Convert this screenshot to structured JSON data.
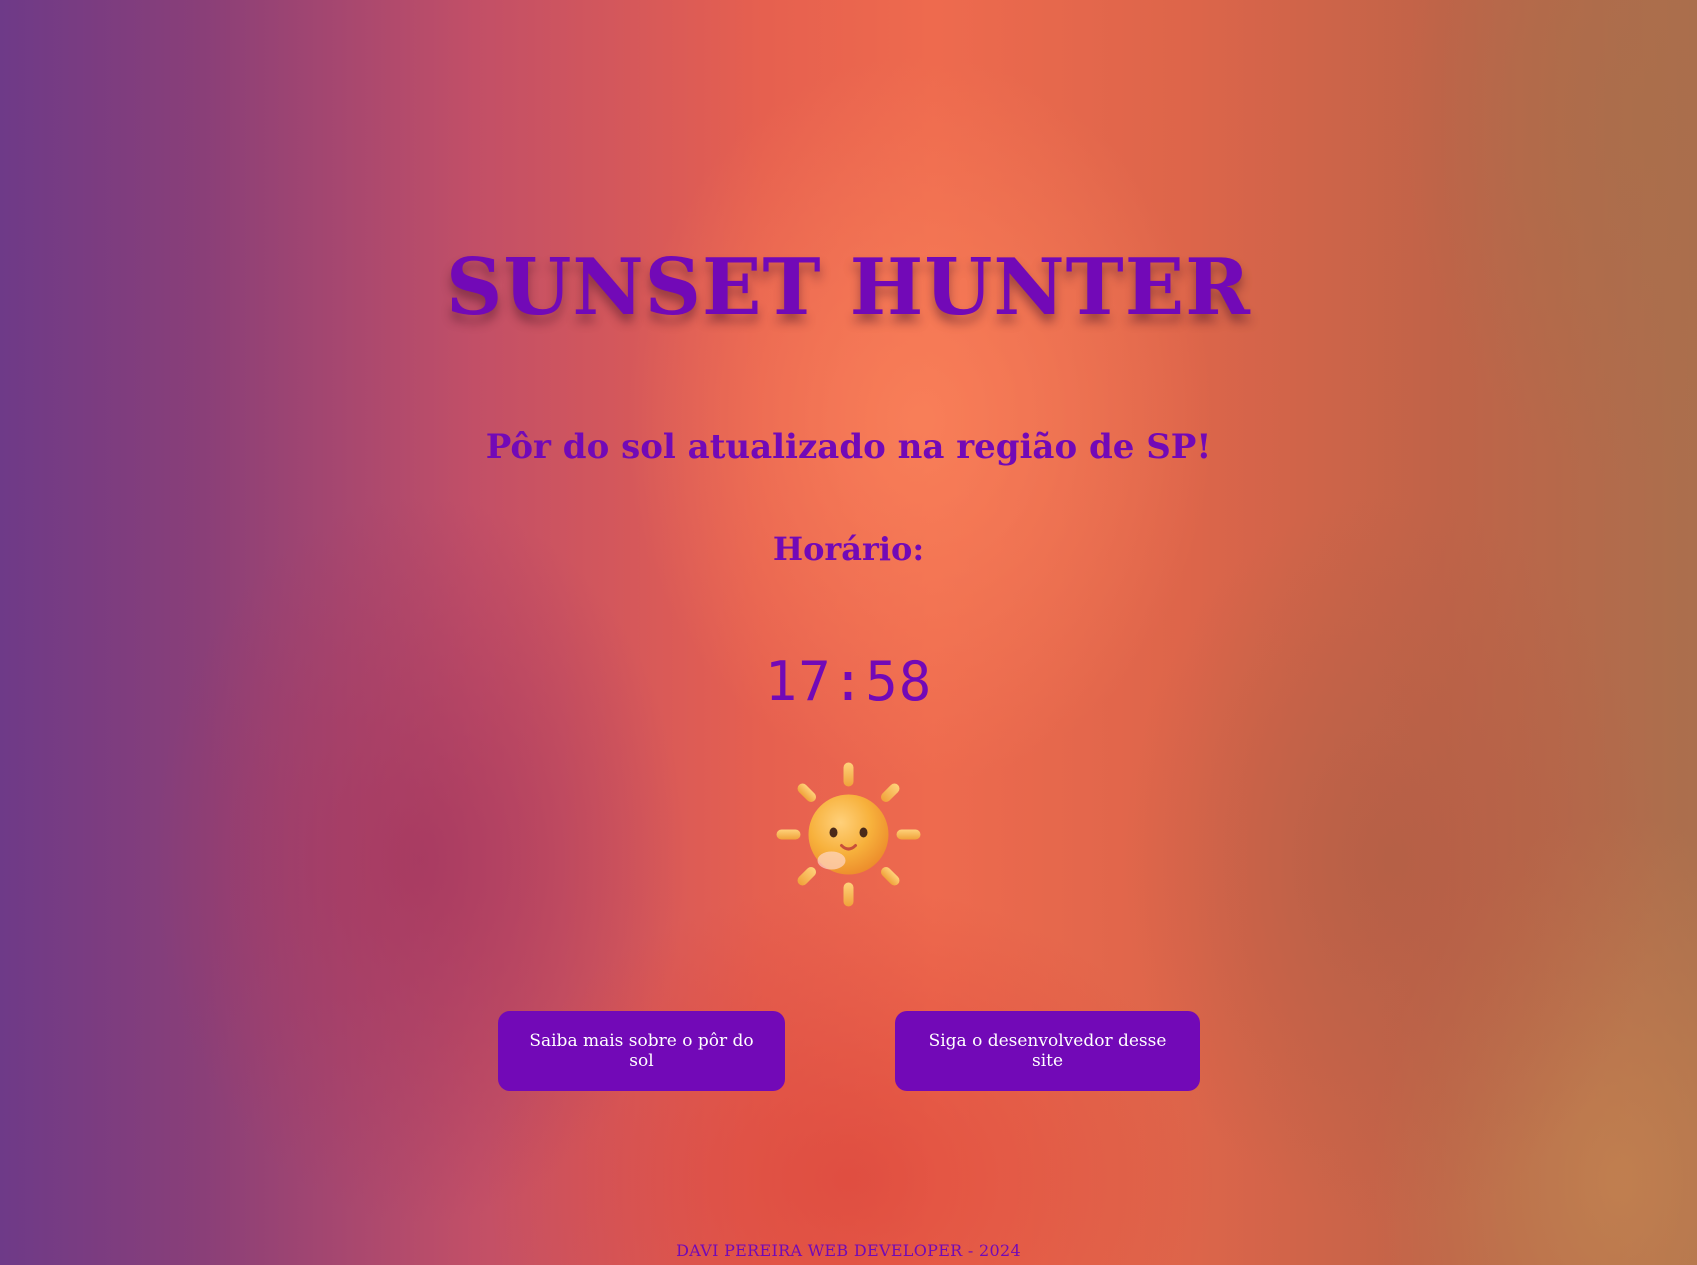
{
  "header": {
    "title": "SUNSET HUNTER"
  },
  "main": {
    "subtitle": "Pôr do sol atualizado na região de SP!",
    "time_label": "Horário:",
    "time_value": "17:58",
    "icon": "smiling-sun-icon"
  },
  "actions": {
    "learn_more_label": "Saiba mais sobre o pôr do sol",
    "follow_dev_label": "Siga o desenvolvedor desse site"
  },
  "footer": {
    "text": "DAVI PEREIRA WEB DEVELOPER - 2024"
  },
  "colors": {
    "accent": "#7209b7",
    "button_text": "#ffffff",
    "sun": "#f7b43c"
  }
}
